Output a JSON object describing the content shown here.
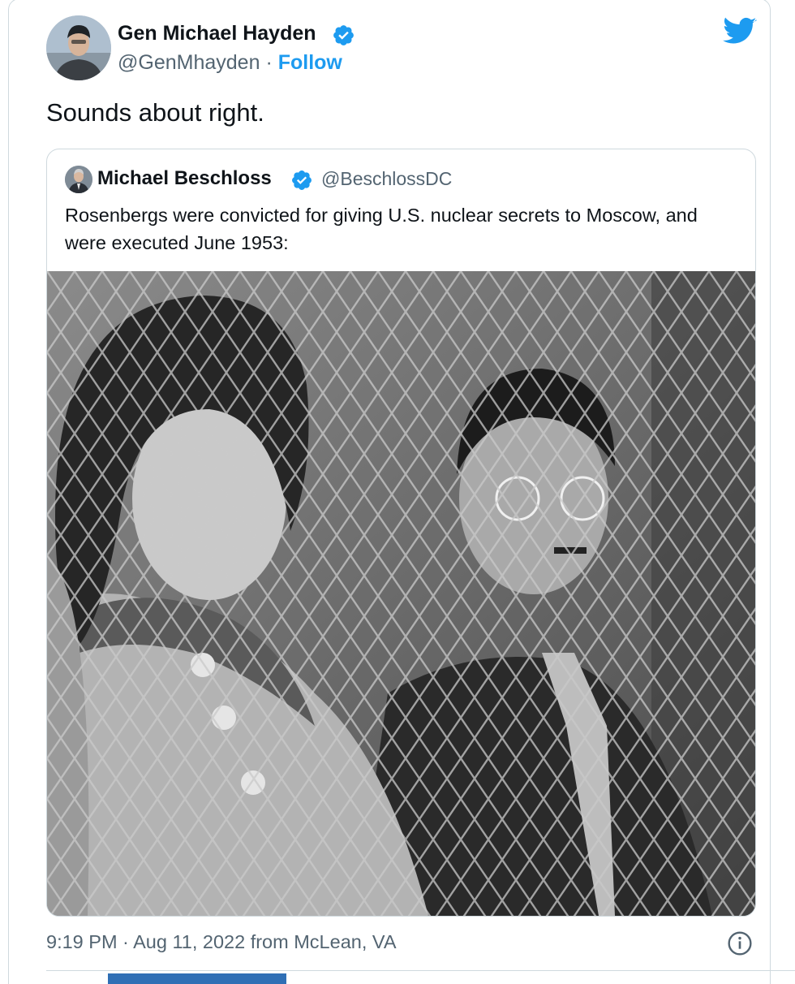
{
  "tweet": {
    "author_name": "Gen Michael Hayden",
    "author_handle": "@GenMhayden",
    "separator": "·",
    "follow_label": "Follow",
    "text": "Sounds about right.",
    "timestamp": "9:19 PM · Aug 11, 2022 from McLean, VA"
  },
  "quoted_tweet": {
    "author_name": "Michael Beschloss",
    "author_handle": "@BeschlossDC",
    "text": "Rosenbergs were convicted for giving U.S. nuclear secrets to Moscow, and were executed June 1953:"
  },
  "icons": {
    "verified": "verified-badge-icon",
    "twitter": "twitter-bird-icon",
    "info": "info-icon"
  },
  "colors": {
    "accent": "#1d9bf0",
    "text_primary": "#0f1419",
    "text_secondary": "#536471",
    "border": "#cfd9de"
  }
}
